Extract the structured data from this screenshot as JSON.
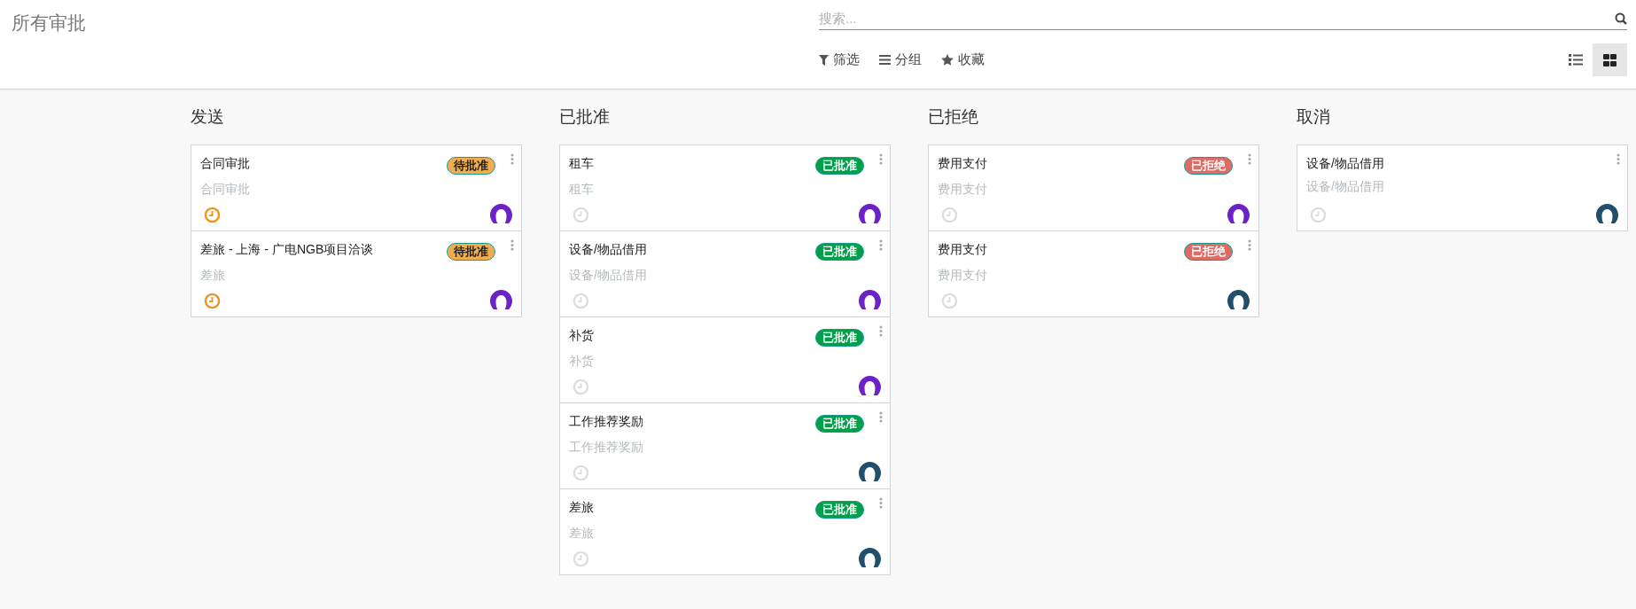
{
  "title": "所有审批",
  "search": {
    "placeholder": "搜索..."
  },
  "filters": [
    {
      "kind": "filter",
      "label": "筛选"
    },
    {
      "kind": "group",
      "label": "分组"
    },
    {
      "kind": "favorite",
      "label": "收藏"
    }
  ],
  "views": [
    {
      "kind": "list",
      "selected": false
    },
    {
      "kind": "kanban",
      "selected": true
    }
  ],
  "columns": [
    {
      "title": "发送",
      "cards": [
        {
          "title": "合同审批",
          "subtitle": "合同审批",
          "kind": "pending",
          "badge": "待批准",
          "activity_due": true,
          "color": "#6c22c4"
        },
        {
          "title": "差旅 - 上海 - 广电NGB项目洽谈",
          "subtitle": "差旅",
          "kind": "pending",
          "badge": "待批准",
          "activity_due": true,
          "color": "#6c22c4"
        }
      ]
    },
    {
      "title": "已批准",
      "cards": [
        {
          "title": "租车",
          "subtitle": "租车",
          "kind": "approved",
          "badge": "已批准",
          "activity_due": false,
          "color": "#6c22c4"
        },
        {
          "title": "设备/物品借用",
          "subtitle": "设备/物品借用",
          "kind": "approved",
          "badge": "已批准",
          "activity_due": false,
          "color": "#6c22c4"
        },
        {
          "title": "补货",
          "subtitle": "补货",
          "kind": "approved",
          "badge": "已批准",
          "activity_due": false,
          "color": "#6c22c4"
        },
        {
          "title": "工作推荐奖励",
          "subtitle": "工作推荐奖励",
          "kind": "approved",
          "badge": "已批准",
          "activity_due": false,
          "color": "#1f4f6a"
        },
        {
          "title": "差旅",
          "subtitle": "差旅",
          "kind": "approved",
          "badge": "已批准",
          "activity_due": false,
          "color": "#1f4f6a"
        }
      ]
    },
    {
      "title": "已拒绝",
      "cards": [
        {
          "title": "费用支付",
          "subtitle": "费用支付",
          "kind": "refused",
          "badge": "已拒绝",
          "activity_due": false,
          "color": "#6c22c4"
        },
        {
          "title": "费用支付",
          "subtitle": "费用支付",
          "kind": "refused",
          "badge": "已拒绝",
          "activity_due": false,
          "color": "#1f4f6a"
        }
      ]
    },
    {
      "title": "取消",
      "cards": [
        {
          "title": "设备/物品借用",
          "subtitle": "设备/物品借用",
          "kind": "cancelled",
          "activity_due": false,
          "color": "#1f4f6a"
        }
      ]
    }
  ]
}
